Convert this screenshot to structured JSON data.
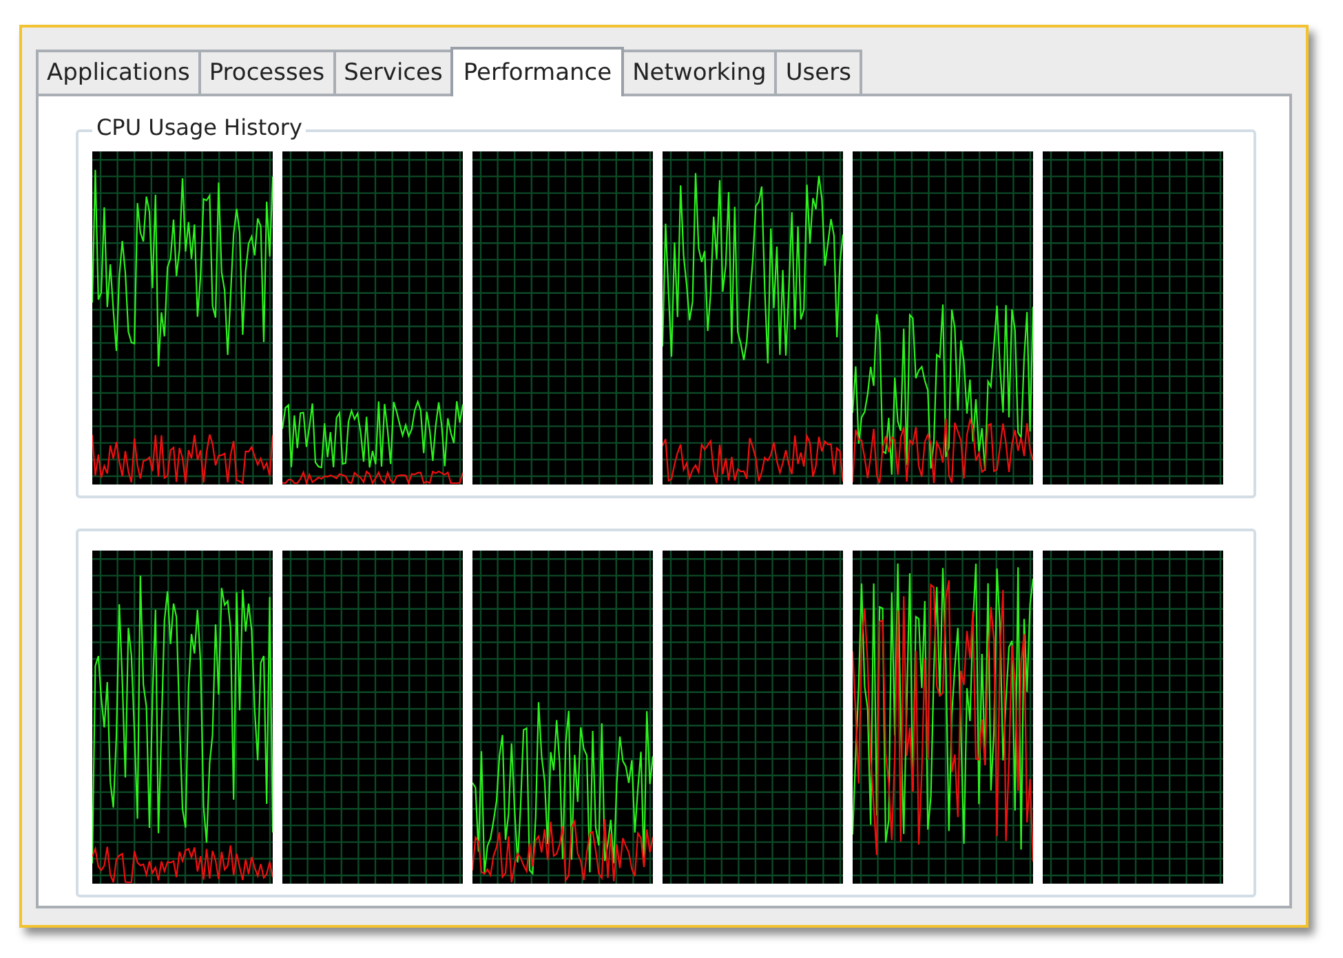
{
  "tabs": [
    {
      "label": "Applications",
      "selected": false
    },
    {
      "label": "Processes",
      "selected": false
    },
    {
      "label": "Services",
      "selected": false
    },
    {
      "label": "Performance",
      "selected": true
    },
    {
      "label": "Networking",
      "selected": false
    },
    {
      "label": "Users",
      "selected": false
    }
  ],
  "groups": [
    {
      "title": "CPU Usage History",
      "graphs": [
        {
          "kind": "busy"
        },
        {
          "kind": "light"
        },
        {
          "kind": "idle"
        },
        {
          "kind": "busy"
        },
        {
          "kind": "medium"
        },
        {
          "kind": "idle"
        }
      ]
    },
    {
      "graphs": [
        {
          "kind": "spiky"
        },
        {
          "kind": "idle"
        },
        {
          "kind": "medium"
        },
        {
          "kind": "idle"
        },
        {
          "kind": "hot"
        },
        {
          "kind": "idle"
        }
      ]
    }
  ]
}
